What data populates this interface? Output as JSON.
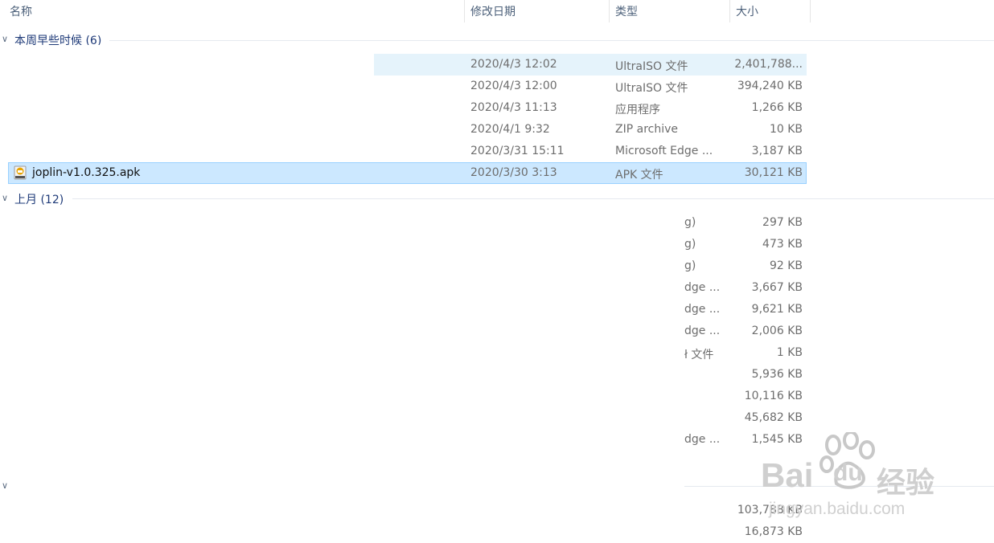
{
  "columns": {
    "name": "名称",
    "modified": "修改日期",
    "type": "类型",
    "size": "大小"
  },
  "groups": [
    {
      "label": "本周早些时候 (6)",
      "rows": [
        {
          "name": "",
          "modified": "2020/4/3 12:02",
          "type": "UltraISO 文件",
          "size": "2,401,788..."
        },
        {
          "name": "",
          "modified": "2020/4/3 12:00",
          "type": "UltraISO 文件",
          "size": "394,240 KB"
        },
        {
          "name": "",
          "modified": "2020/4/3 11:13",
          "type": "应用程序",
          "size": "1,266 KB"
        },
        {
          "name": "",
          "modified": "2020/4/1 9:32",
          "type": "ZIP archive",
          "size": "10 KB"
        },
        {
          "name": "",
          "modified": "2020/3/31 15:11",
          "type": "Microsoft Edge ...",
          "size": "3,187 KB"
        },
        {
          "name": "joplin-v1.0.325.apk",
          "modified": "2020/3/30 3:13",
          "type": "APK 文件",
          "size": "30,121 KB"
        }
      ]
    },
    {
      "label": "上月 (12)",
      "rows": [
        {
          "type": "g)",
          "size": "297 KB"
        },
        {
          "type": "g)",
          "size": "473 KB"
        },
        {
          "type": "g)",
          "size": "92 KB"
        },
        {
          "type": "dge ...",
          "size": "3,667 KB"
        },
        {
          "type": "dge ...",
          "size": "9,621 KB"
        },
        {
          "type": "dge ...",
          "size": "2,006 KB"
        },
        {
          "type": "ł 文件",
          "size": "1 KB"
        },
        {
          "type": "",
          "size": "5,936 KB"
        },
        {
          "type": "",
          "size": "10,116 KB"
        },
        {
          "type": "",
          "size": "45,682 KB"
        },
        {
          "type": "dge ...",
          "size": "1,545 KB"
        }
      ]
    },
    {
      "label": "",
      "rows": [
        {
          "size": "103,788 KB"
        },
        {
          "size": "16,873 KB"
        }
      ]
    }
  ],
  "watermark": {
    "brand": "Bai",
    "brand2": "du",
    "cn": "经验",
    "url": "jingyan.baidu.com"
  }
}
